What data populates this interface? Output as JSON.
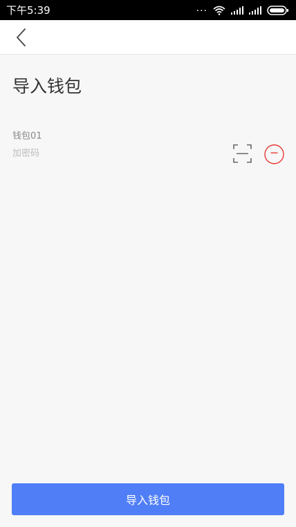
{
  "status_bar": {
    "time": "下午5:39",
    "dots": "...",
    "icons": [
      "wifi-icon",
      "signal-icon",
      "signal-icon",
      "battery-icon"
    ]
  },
  "header": {
    "back_icon": "chevron-left-icon"
  },
  "page": {
    "title": "导入钱包"
  },
  "wallet_entry": {
    "name": "钱包01",
    "password_placeholder": "加密码",
    "password_value": "",
    "scan_icon": "scan-icon",
    "remove_icon": "minus-circle-icon",
    "remove_color": "#e53935"
  },
  "footer": {
    "import_button_label": "导入钱包",
    "button_color": "#4f7ef7"
  }
}
